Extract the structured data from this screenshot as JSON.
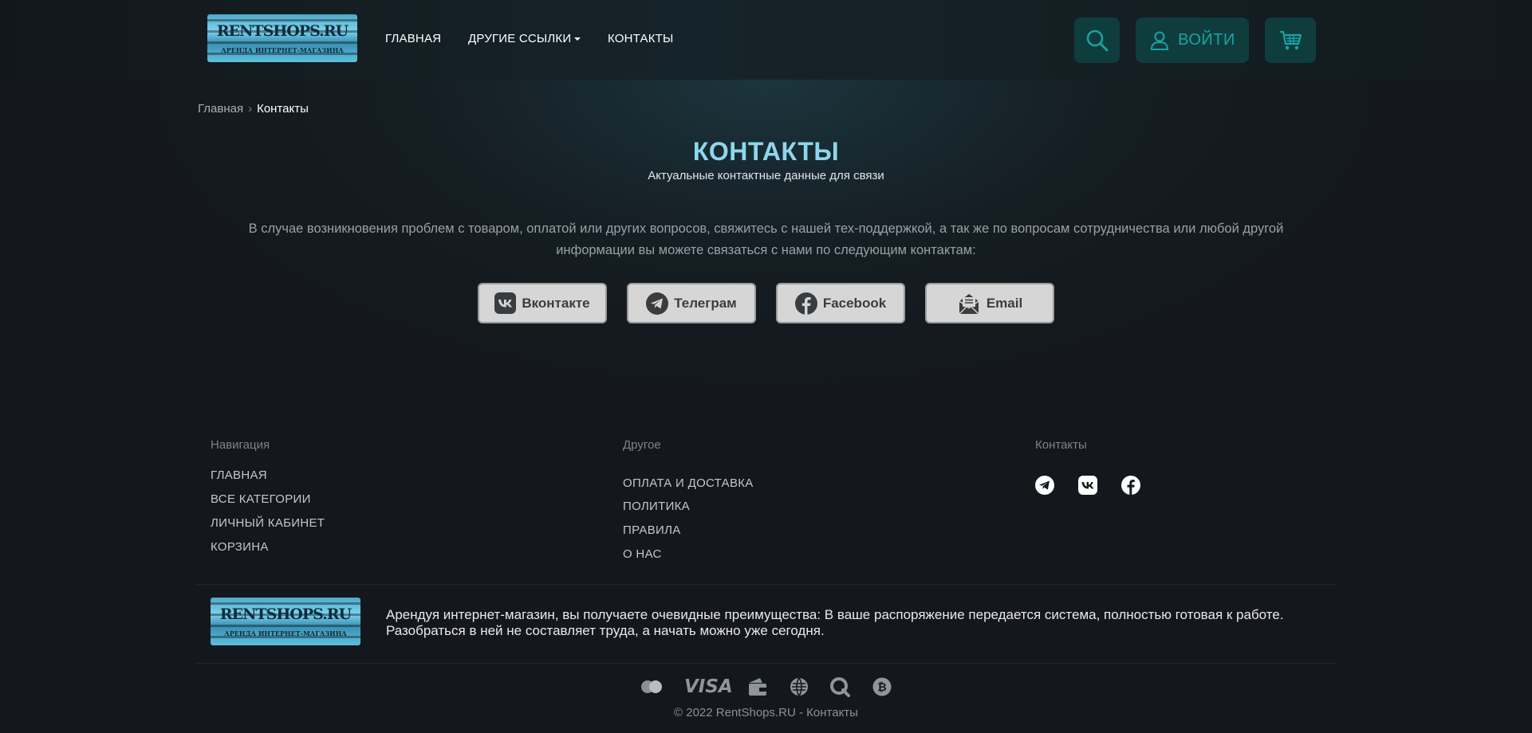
{
  "header": {
    "logo": {
      "title": "RENTSHOPS.RU",
      "tagline": "АРЕНДА ИНТЕРНЕТ-МАГАЗИНА"
    },
    "nav": [
      {
        "label": "ГЛАВНАЯ"
      },
      {
        "label": "ДРУГИЕ ССЫЛКИ"
      },
      {
        "label": "КОНТАКТЫ"
      }
    ],
    "search_icon": "search-icon",
    "login_label": "ВОЙТИ",
    "login_icon": "user-icon",
    "cart_icon": "cart-icon",
    "accent_color": "#1aa3a3"
  },
  "breadcrumb": {
    "home": "Главная",
    "current": "Контакты"
  },
  "page": {
    "title": "КОНТАКТЫ",
    "subtitle": "Актуальные контактные данные для связи",
    "description": "В случае возникновения проблем с товаром, оплатой или других вопросов, свяжитесь с нашей тех-поддержкой, а так же по вопросам сотрудничества или любой другой информации вы можете связаться с нами по следующим контактам:",
    "title_color": "#8fd6ec"
  },
  "contact_buttons": [
    {
      "label": "Вконтакте",
      "icon": "vk-icon"
    },
    {
      "label": "Телеграм",
      "icon": "telegram-icon"
    },
    {
      "label": "Facebook",
      "icon": "facebook-icon"
    },
    {
      "label": "Email",
      "icon": "email-icon"
    }
  ],
  "footer": {
    "navigation": {
      "heading": "Навигация",
      "links": [
        "ГЛАВНАЯ",
        "ВСЕ КАТЕГОРИИ",
        "ЛИЧНЫЙ КАБИНЕТ",
        "КОРЗИНА"
      ]
    },
    "other": {
      "heading": "Другое",
      "links": [
        "ОПЛАТА И ДОСТАВКА",
        "ПОЛИТИКА",
        "ПРАВИЛА",
        "О НАС"
      ]
    },
    "contacts": {
      "heading": "Контакты",
      "icons": [
        "telegram-icon",
        "vk-icon",
        "facebook-icon"
      ]
    },
    "about": "Арендуя интернет-магазин, вы получаете очевидные преимущества: В ваше распоряжение передается система, полностью готовая к работе. Разобраться в ней не составляет труда, а начать можно уже сегодня.",
    "payments": [
      "mastercard-icon",
      "visa-icon",
      "wallet-icon",
      "webmoney-icon",
      "qiwi-icon",
      "bitcoin-icon"
    ],
    "payment_visa_label": "VISA",
    "copyright": "© 2022 RentShops.RU - Контакты"
  }
}
